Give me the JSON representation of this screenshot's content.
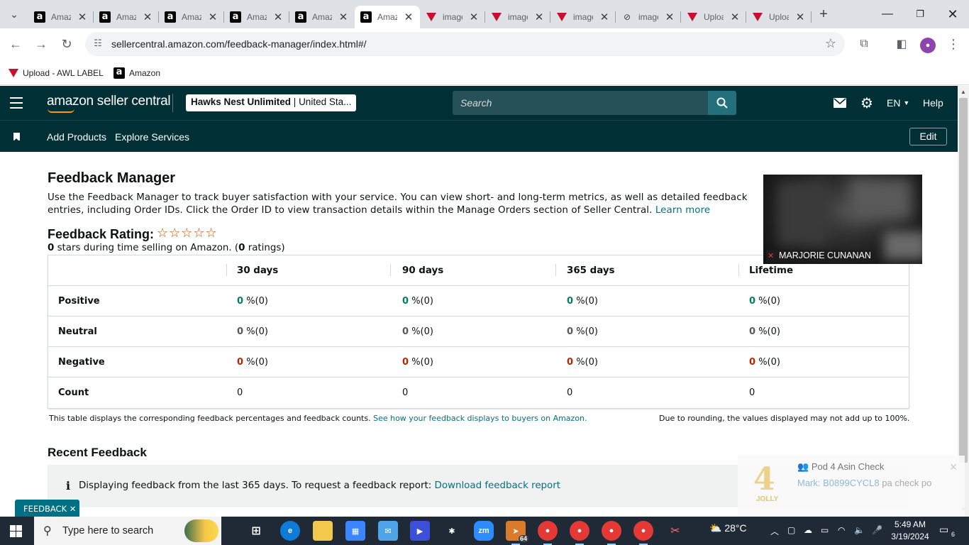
{
  "browser": {
    "tabs": [
      {
        "title": "Amazon",
        "icon": "amazon-icon",
        "active": false
      },
      {
        "title": "Amazon",
        "icon": "amazon-icon",
        "active": false
      },
      {
        "title": "Amazon",
        "icon": "amazon-icon",
        "active": false
      },
      {
        "title": "Amazon",
        "icon": "amazon-icon",
        "active": false
      },
      {
        "title": "Amazon",
        "icon": "amazon-icon",
        "active": false
      },
      {
        "title": "Amazon",
        "icon": "amazon-icon",
        "active": true
      },
      {
        "title": "image",
        "icon": "awl-icon",
        "active": false
      },
      {
        "title": "image",
        "icon": "awl-icon",
        "active": false
      },
      {
        "title": "image",
        "icon": "awl-icon",
        "active": false
      },
      {
        "title": "image",
        "icon": "link-icon",
        "active": false
      },
      {
        "title": "Upload",
        "icon": "awl-icon",
        "active": false
      },
      {
        "title": "Upload",
        "icon": "awl-icon",
        "active": false
      }
    ],
    "url": "sellercentral.amazon.com/feedback-manager/index.html#/",
    "bookmarks": [
      {
        "label": "Upload - AWL LABEL",
        "icon": "awl-icon"
      },
      {
        "label": "Amazon",
        "icon": "amazon-icon"
      }
    ]
  },
  "header": {
    "logo": "amazon seller central",
    "store_name": "Hawks Nest Unlimited",
    "store_region": "United Sta...",
    "search_placeholder": "Search",
    "language": "EN",
    "help": "Help"
  },
  "subnav": {
    "links": [
      "Add Products",
      "Explore Services"
    ],
    "edit": "Edit"
  },
  "page": {
    "title": "Feedback Manager",
    "intro_text": "Use the Feedback Manager to track buyer satisfaction with your service. You can view short- and long-term metrics, as well as detailed feedback entries, including Order IDs. Click the Order ID to view transaction details within the Manage Orders section of Seller Central.",
    "learn_more": "Learn more",
    "rating_title": "Feedback Rating:",
    "rating_stars": "☆☆☆☆☆",
    "rating_value": "0",
    "rating_text_mid": " stars during time selling on Amazon. (",
    "rating_count": "0",
    "rating_text_end": " ratings)"
  },
  "table": {
    "columns": [
      "30 days",
      "90 days",
      "365 days",
      "Lifetime"
    ],
    "rows": [
      {
        "label": "Positive",
        "values": [
          "0",
          "0",
          "0",
          "0"
        ],
        "counts": [
          "%(0)",
          "%(0)",
          "%(0)",
          "%(0)"
        ]
      },
      {
        "label": "Neutral",
        "values": [
          "0",
          "0",
          "0",
          "0"
        ],
        "counts": [
          "%(0)",
          "%(0)",
          "%(0)",
          "%(0)"
        ]
      },
      {
        "label": "Negative",
        "values": [
          "0",
          "0",
          "0",
          "0"
        ],
        "counts": [
          "%(0)",
          "%(0)",
          "%(0)",
          "%(0)"
        ]
      },
      {
        "label": "Count",
        "values": [
          "0",
          "0",
          "0",
          "0"
        ]
      }
    ],
    "note": "This table displays the corresponding feedback percentages and feedback counts.",
    "note_link": "See how your feedback displays to buyers on Amazon.",
    "rounding_note": "Due to rounding, the values displayed may not add up to 100%."
  },
  "recent": {
    "title": "Recent Feedback",
    "info": "Displaying feedback from the last 365 days. To request a feedback report:",
    "info_link": "Download feedback report"
  },
  "video": {
    "participant": "MARJORIE CUNANAN"
  },
  "notification": {
    "badge": "4",
    "badge_label": "JOLLY",
    "title": "Pod 4 Asin Check",
    "sender": "Mark:",
    "code": "B0899CYCL8",
    "message": "pa check po"
  },
  "feedback_tab": "FEEDBACK ✕",
  "taskbar": {
    "search_placeholder": "Type here to search",
    "temperature": "28°C",
    "time": "5:49 AM",
    "date": "3/19/2024",
    "telegram_badge": "64",
    "notifications": "6"
  }
}
